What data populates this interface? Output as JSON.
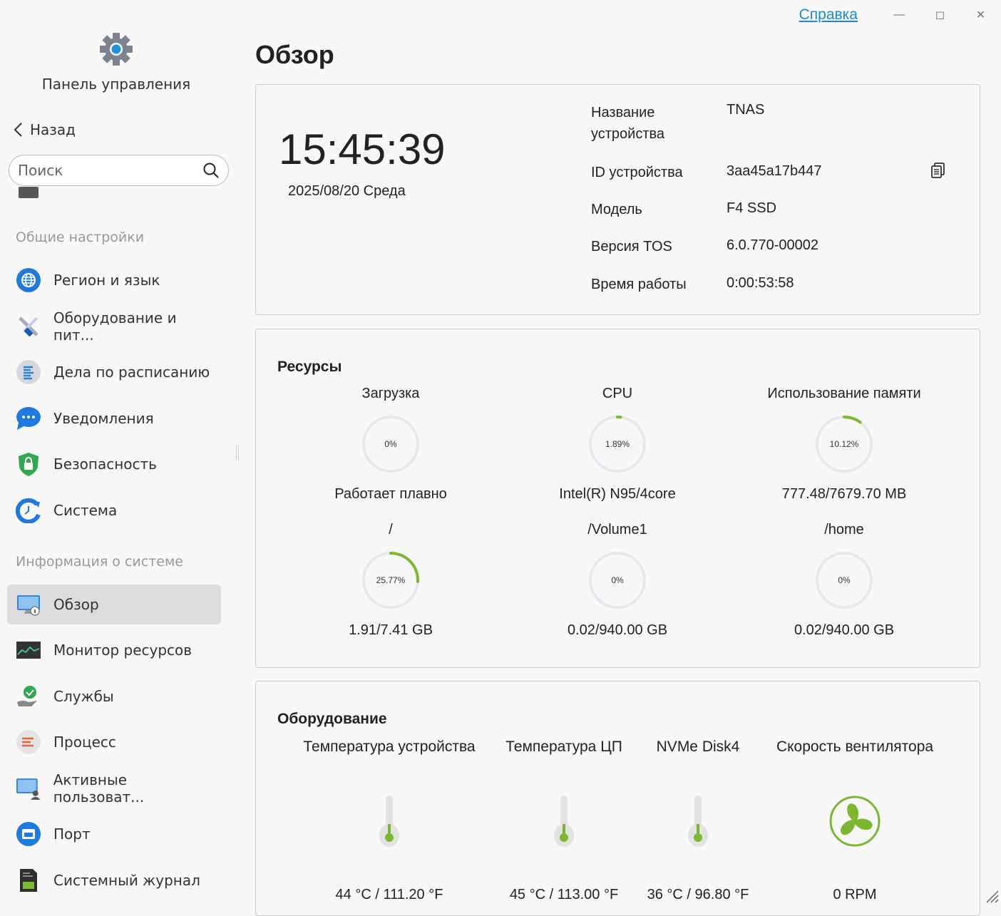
{
  "app": {
    "title": "Панель управления",
    "back": "Назад",
    "search_placeholder": "Поиск",
    "help": "Справка"
  },
  "colors": {
    "accent": "#7cb82f",
    "track": "#e3e8ee",
    "link": "#1a8ad6",
    "active": "#dcdcdc"
  },
  "sidebar": {
    "sections": [
      {
        "title": "Общие настройки",
        "items": [
          {
            "label": "Регион и язык",
            "icon": "globe-icon"
          },
          {
            "label": "Оборудование и пит...",
            "icon": "tools-icon"
          },
          {
            "label": "Дела по расписанию",
            "icon": "schedule-list-icon"
          },
          {
            "label": "Уведомления",
            "icon": "chat-bubble-icon"
          },
          {
            "label": "Безопасность",
            "icon": "shield-lock-icon"
          },
          {
            "label": "Система",
            "icon": "system-clock-icon"
          }
        ]
      },
      {
        "title": "Информация о системе",
        "items": [
          {
            "label": "Обзор",
            "icon": "monitor-info-icon",
            "active": true
          },
          {
            "label": "Монитор ресурсов",
            "icon": "resource-monitor-icon"
          },
          {
            "label": "Службы",
            "icon": "services-icon"
          },
          {
            "label": "Процесс",
            "icon": "process-icon"
          },
          {
            "label": "Активные пользоват...",
            "icon": "active-users-icon"
          },
          {
            "label": "Порт",
            "icon": "port-icon"
          },
          {
            "label": "Системный журнал",
            "icon": "system-log-icon"
          }
        ]
      }
    ]
  },
  "main": {
    "title": "Обзор",
    "device": {
      "time": "15:45:39",
      "date": "2025/08/20 Среда",
      "fields": [
        {
          "label": "Название устройства",
          "value": "TNAS"
        },
        {
          "label": "ID устройства",
          "value": "3aa45a17b447",
          "copy": true
        },
        {
          "label": "Модель",
          "value": "F4 SSD"
        },
        {
          "label": "Версия TOS",
          "value": "6.0.770-00002"
        },
        {
          "label": "Время работы",
          "value": "0:00:53:58"
        }
      ]
    },
    "resources": {
      "title": "Ресурсы",
      "gauges": [
        {
          "top": "Загрузка",
          "percent": 0,
          "pct_label": "0%",
          "bottom": "Работает плавно"
        },
        {
          "top": "CPU",
          "percent": 1.89,
          "pct_label": "1.89%",
          "bottom": "Intel(R) N95/4core"
        },
        {
          "top": "Использование памяти",
          "percent": 10.12,
          "pct_label": "10.12%",
          "bottom": "777.48/7679.70 MB"
        },
        {
          "top": "/",
          "percent": 25.77,
          "pct_label": "25.77%",
          "bottom": "1.91/7.41 GB"
        },
        {
          "top": "/Volume1",
          "percent": 0,
          "pct_label": "0%",
          "bottom": "0.02/940.00 GB"
        },
        {
          "top": "/home",
          "percent": 0,
          "pct_label": "0%",
          "bottom": "0.02/940.00 GB"
        }
      ]
    },
    "hardware": {
      "title": "Оборудование",
      "items": [
        {
          "label": "Температура устройства",
          "value": "44 °C / 111.20 °F",
          "type": "thermometer",
          "level": 0.5
        },
        {
          "label": "Температура ЦП",
          "value": "45 °C / 113.00 °F",
          "type": "thermometer",
          "level": 0.5
        },
        {
          "label": "NVMe Disk4",
          "value": "36 °C / 96.80 °F",
          "type": "thermometer",
          "level": 0.5
        },
        {
          "label": "Скорость вентилятора",
          "value": "0 RPM",
          "type": "fan"
        }
      ]
    }
  }
}
